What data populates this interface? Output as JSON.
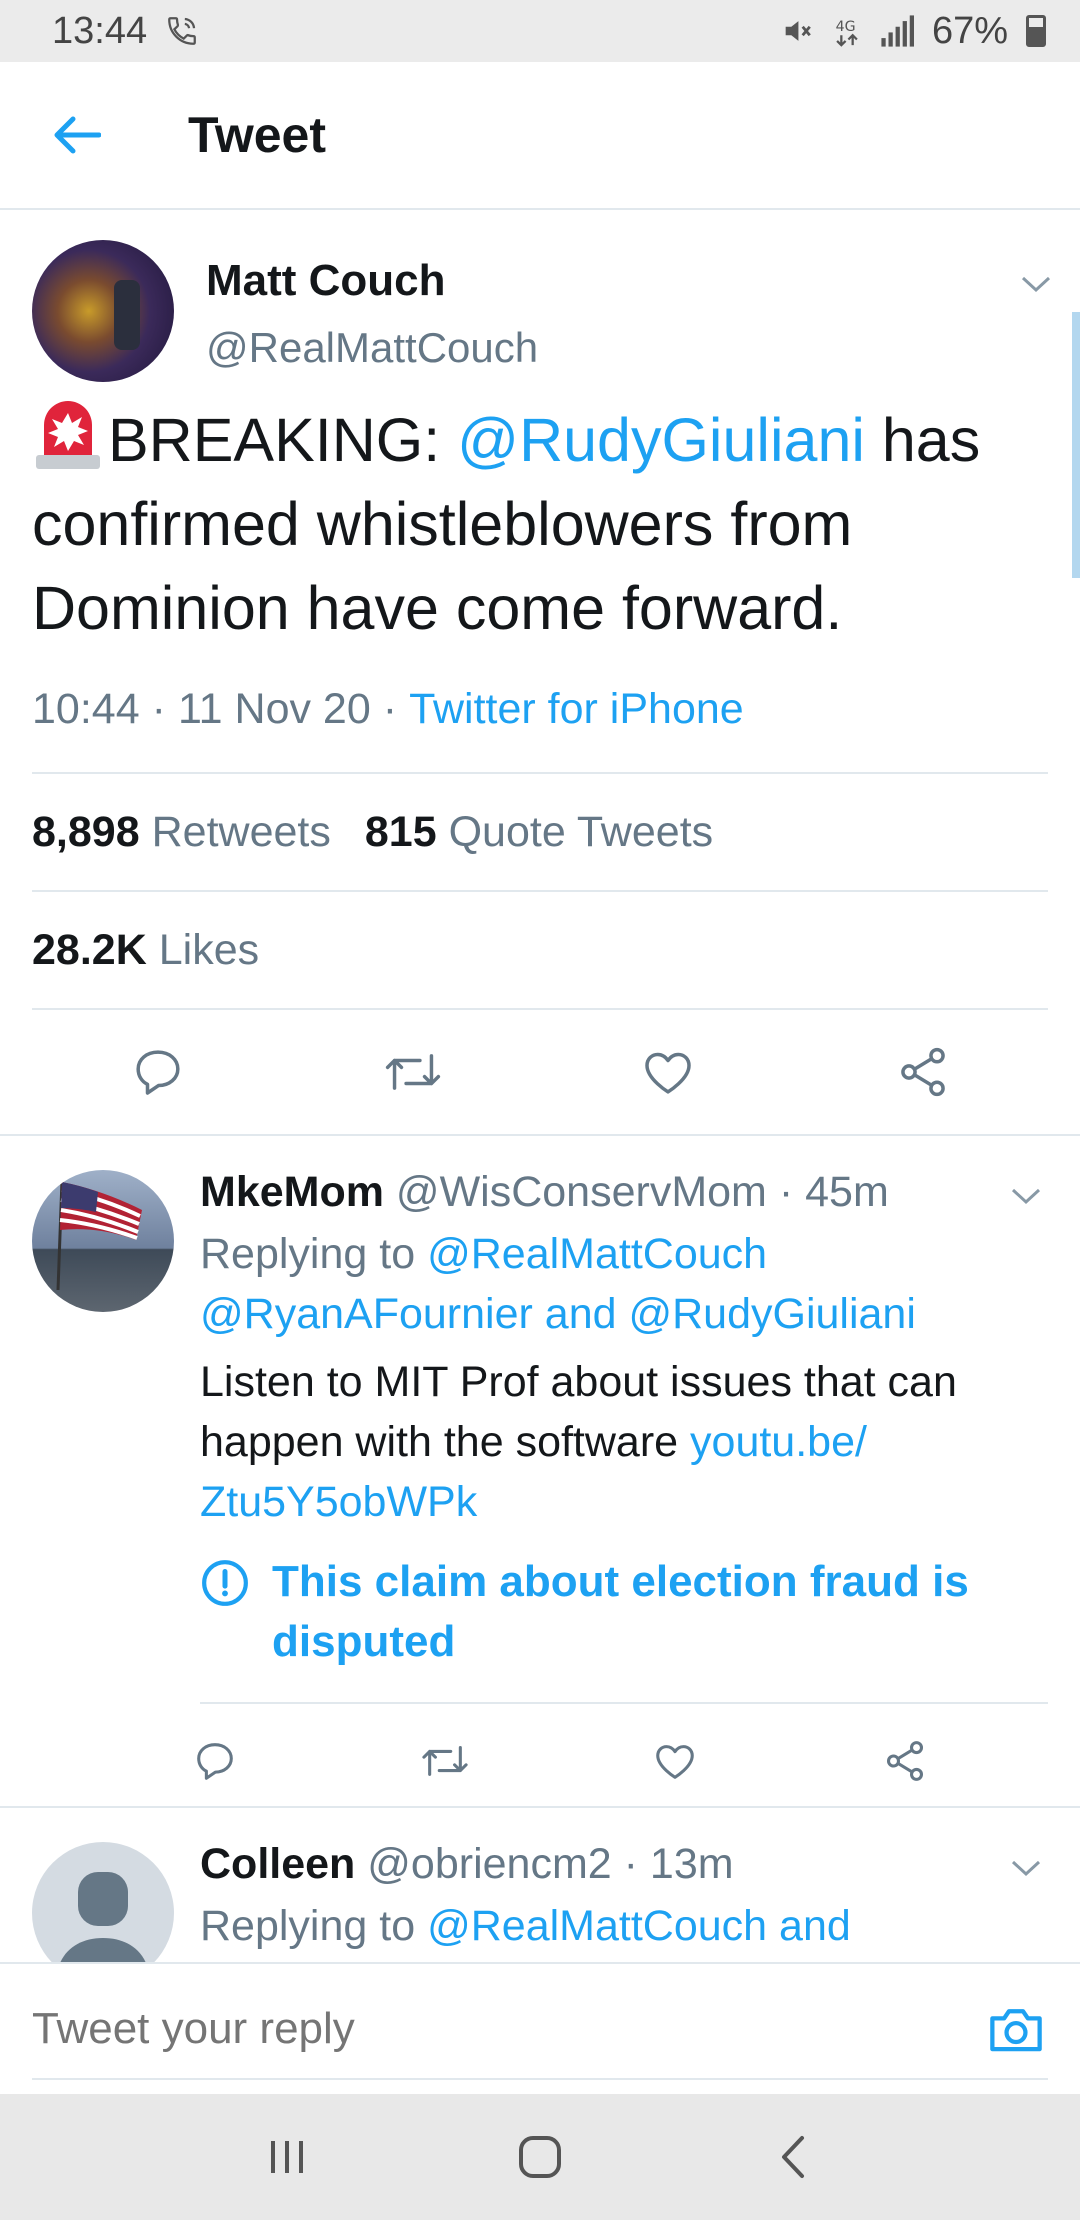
{
  "status_bar": {
    "time": "13:44",
    "battery": "67%"
  },
  "app_bar": {
    "title": "Tweet"
  },
  "main_tweet": {
    "name": "Matt Couch",
    "handle": "@RealMattCouch",
    "text_prefix": "BREAKING: ",
    "mention": "@RudyGiuliani",
    "text_suffix": " has confirmed whistleblowers from Dominion have come forward.",
    "time": "10:44",
    "date": "11 Nov 20",
    "source": "Twitter for iPhone",
    "retweets_count": "8,898",
    "retweets_label": "Retweets",
    "quotes_count": "815",
    "quotes_label": "Quote Tweets",
    "likes_count": "28.2K",
    "likes_label": "Likes"
  },
  "replies": [
    {
      "name": "MkeMom",
      "handle": "@WisConservMom",
      "age": "45m",
      "replying_prefix": "Replying to ",
      "replying_line1": "@RealMattCouch",
      "replying_line2": "@RyanAFournier and @RudyGiuliani",
      "text": "Listen to MIT Prof about issues that can happen with the software ",
      "link_line1": "youtu.be/",
      "link_line2": "Ztu5Y5obWPk",
      "notice": "This claim about election fraud is disputed"
    },
    {
      "name": "Colleen",
      "handle": "@obriencm2",
      "age": "13m",
      "replying_prefix": "Replying to ",
      "replying_line1": "@RealMattCouch and"
    }
  ],
  "composer": {
    "placeholder": "Tweet your reply"
  },
  "colors": {
    "accent": "#1da1f2",
    "secondary_text": "#657786",
    "divider": "#e1e8ed"
  },
  "icons": [
    "phone-call-icon",
    "mute-icon",
    "data-icon",
    "signal-icon",
    "battery-icon",
    "back-arrow-icon",
    "chevron-down-icon",
    "siren-emoji",
    "reply-icon",
    "retweet-icon",
    "like-icon",
    "share-icon",
    "info-icon",
    "camera-icon",
    "recents-icon",
    "home-icon",
    "nav-back-icon"
  ]
}
